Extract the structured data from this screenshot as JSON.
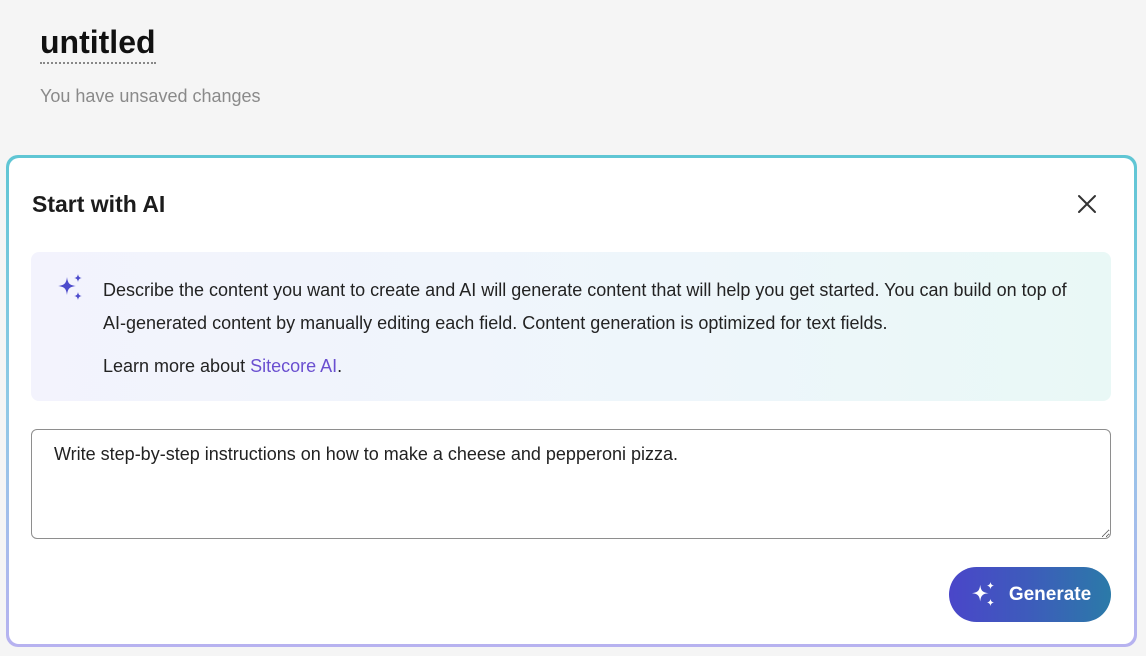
{
  "header": {
    "title": "untitled",
    "status": "You have unsaved changes"
  },
  "panel": {
    "title": "Start with AI",
    "close_icon": "close-icon",
    "info": {
      "icon": "sparkles-icon",
      "description": "Describe the content you want to create and AI will generate content that will help you get started. You can build on top of AI-generated content by manually editing each field. Content generation is optimized for text fields.",
      "learn_more_prefix": "Learn more about ",
      "learn_more_link": "Sitecore AI",
      "learn_more_suffix": "."
    },
    "prompt": {
      "value": "Write step-by-step instructions on how to make a cheese and pepperoni pizza."
    },
    "generate_button": {
      "label": "Generate",
      "icon": "sparkles-icon"
    }
  },
  "colors": {
    "accent": "#4a46c9",
    "link": "#6a4fd0",
    "panel_border_top": "#5fc6d4",
    "panel_border_bottom": "#b7b2f0"
  }
}
